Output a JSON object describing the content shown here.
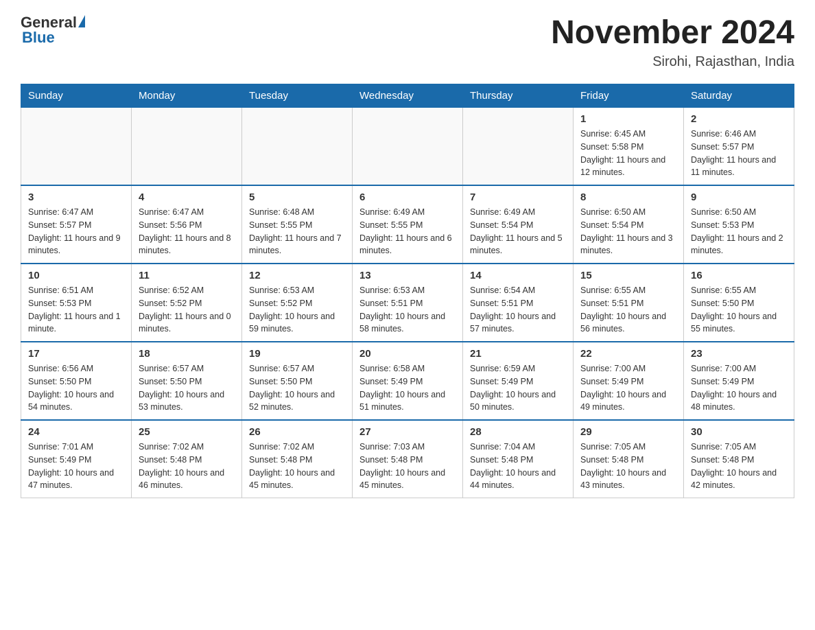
{
  "header": {
    "logo_general": "General",
    "logo_blue": "Blue",
    "month_title": "November 2024",
    "location": "Sirohi, Rajasthan, India"
  },
  "weekdays": [
    "Sunday",
    "Monday",
    "Tuesday",
    "Wednesday",
    "Thursday",
    "Friday",
    "Saturday"
  ],
  "weeks": [
    [
      {
        "day": "",
        "sunrise": "",
        "sunset": "",
        "daylight": ""
      },
      {
        "day": "",
        "sunrise": "",
        "sunset": "",
        "daylight": ""
      },
      {
        "day": "",
        "sunrise": "",
        "sunset": "",
        "daylight": ""
      },
      {
        "day": "",
        "sunrise": "",
        "sunset": "",
        "daylight": ""
      },
      {
        "day": "",
        "sunrise": "",
        "sunset": "",
        "daylight": ""
      },
      {
        "day": "1",
        "sunrise": "Sunrise: 6:45 AM",
        "sunset": "Sunset: 5:58 PM",
        "daylight": "Daylight: 11 hours and 12 minutes."
      },
      {
        "day": "2",
        "sunrise": "Sunrise: 6:46 AM",
        "sunset": "Sunset: 5:57 PM",
        "daylight": "Daylight: 11 hours and 11 minutes."
      }
    ],
    [
      {
        "day": "3",
        "sunrise": "Sunrise: 6:47 AM",
        "sunset": "Sunset: 5:57 PM",
        "daylight": "Daylight: 11 hours and 9 minutes."
      },
      {
        "day": "4",
        "sunrise": "Sunrise: 6:47 AM",
        "sunset": "Sunset: 5:56 PM",
        "daylight": "Daylight: 11 hours and 8 minutes."
      },
      {
        "day": "5",
        "sunrise": "Sunrise: 6:48 AM",
        "sunset": "Sunset: 5:55 PM",
        "daylight": "Daylight: 11 hours and 7 minutes."
      },
      {
        "day": "6",
        "sunrise": "Sunrise: 6:49 AM",
        "sunset": "Sunset: 5:55 PM",
        "daylight": "Daylight: 11 hours and 6 minutes."
      },
      {
        "day": "7",
        "sunrise": "Sunrise: 6:49 AM",
        "sunset": "Sunset: 5:54 PM",
        "daylight": "Daylight: 11 hours and 5 minutes."
      },
      {
        "day": "8",
        "sunrise": "Sunrise: 6:50 AM",
        "sunset": "Sunset: 5:54 PM",
        "daylight": "Daylight: 11 hours and 3 minutes."
      },
      {
        "day": "9",
        "sunrise": "Sunrise: 6:50 AM",
        "sunset": "Sunset: 5:53 PM",
        "daylight": "Daylight: 11 hours and 2 minutes."
      }
    ],
    [
      {
        "day": "10",
        "sunrise": "Sunrise: 6:51 AM",
        "sunset": "Sunset: 5:53 PM",
        "daylight": "Daylight: 11 hours and 1 minute."
      },
      {
        "day": "11",
        "sunrise": "Sunrise: 6:52 AM",
        "sunset": "Sunset: 5:52 PM",
        "daylight": "Daylight: 11 hours and 0 minutes."
      },
      {
        "day": "12",
        "sunrise": "Sunrise: 6:53 AM",
        "sunset": "Sunset: 5:52 PM",
        "daylight": "Daylight: 10 hours and 59 minutes."
      },
      {
        "day": "13",
        "sunrise": "Sunrise: 6:53 AM",
        "sunset": "Sunset: 5:51 PM",
        "daylight": "Daylight: 10 hours and 58 minutes."
      },
      {
        "day": "14",
        "sunrise": "Sunrise: 6:54 AM",
        "sunset": "Sunset: 5:51 PM",
        "daylight": "Daylight: 10 hours and 57 minutes."
      },
      {
        "day": "15",
        "sunrise": "Sunrise: 6:55 AM",
        "sunset": "Sunset: 5:51 PM",
        "daylight": "Daylight: 10 hours and 56 minutes."
      },
      {
        "day": "16",
        "sunrise": "Sunrise: 6:55 AM",
        "sunset": "Sunset: 5:50 PM",
        "daylight": "Daylight: 10 hours and 55 minutes."
      }
    ],
    [
      {
        "day": "17",
        "sunrise": "Sunrise: 6:56 AM",
        "sunset": "Sunset: 5:50 PM",
        "daylight": "Daylight: 10 hours and 54 minutes."
      },
      {
        "day": "18",
        "sunrise": "Sunrise: 6:57 AM",
        "sunset": "Sunset: 5:50 PM",
        "daylight": "Daylight: 10 hours and 53 minutes."
      },
      {
        "day": "19",
        "sunrise": "Sunrise: 6:57 AM",
        "sunset": "Sunset: 5:50 PM",
        "daylight": "Daylight: 10 hours and 52 minutes."
      },
      {
        "day": "20",
        "sunrise": "Sunrise: 6:58 AM",
        "sunset": "Sunset: 5:49 PM",
        "daylight": "Daylight: 10 hours and 51 minutes."
      },
      {
        "day": "21",
        "sunrise": "Sunrise: 6:59 AM",
        "sunset": "Sunset: 5:49 PM",
        "daylight": "Daylight: 10 hours and 50 minutes."
      },
      {
        "day": "22",
        "sunrise": "Sunrise: 7:00 AM",
        "sunset": "Sunset: 5:49 PM",
        "daylight": "Daylight: 10 hours and 49 minutes."
      },
      {
        "day": "23",
        "sunrise": "Sunrise: 7:00 AM",
        "sunset": "Sunset: 5:49 PM",
        "daylight": "Daylight: 10 hours and 48 minutes."
      }
    ],
    [
      {
        "day": "24",
        "sunrise": "Sunrise: 7:01 AM",
        "sunset": "Sunset: 5:49 PM",
        "daylight": "Daylight: 10 hours and 47 minutes."
      },
      {
        "day": "25",
        "sunrise": "Sunrise: 7:02 AM",
        "sunset": "Sunset: 5:48 PM",
        "daylight": "Daylight: 10 hours and 46 minutes."
      },
      {
        "day": "26",
        "sunrise": "Sunrise: 7:02 AM",
        "sunset": "Sunset: 5:48 PM",
        "daylight": "Daylight: 10 hours and 45 minutes."
      },
      {
        "day": "27",
        "sunrise": "Sunrise: 7:03 AM",
        "sunset": "Sunset: 5:48 PM",
        "daylight": "Daylight: 10 hours and 45 minutes."
      },
      {
        "day": "28",
        "sunrise": "Sunrise: 7:04 AM",
        "sunset": "Sunset: 5:48 PM",
        "daylight": "Daylight: 10 hours and 44 minutes."
      },
      {
        "day": "29",
        "sunrise": "Sunrise: 7:05 AM",
        "sunset": "Sunset: 5:48 PM",
        "daylight": "Daylight: 10 hours and 43 minutes."
      },
      {
        "day": "30",
        "sunrise": "Sunrise: 7:05 AM",
        "sunset": "Sunset: 5:48 PM",
        "daylight": "Daylight: 10 hours and 42 minutes."
      }
    ]
  ]
}
